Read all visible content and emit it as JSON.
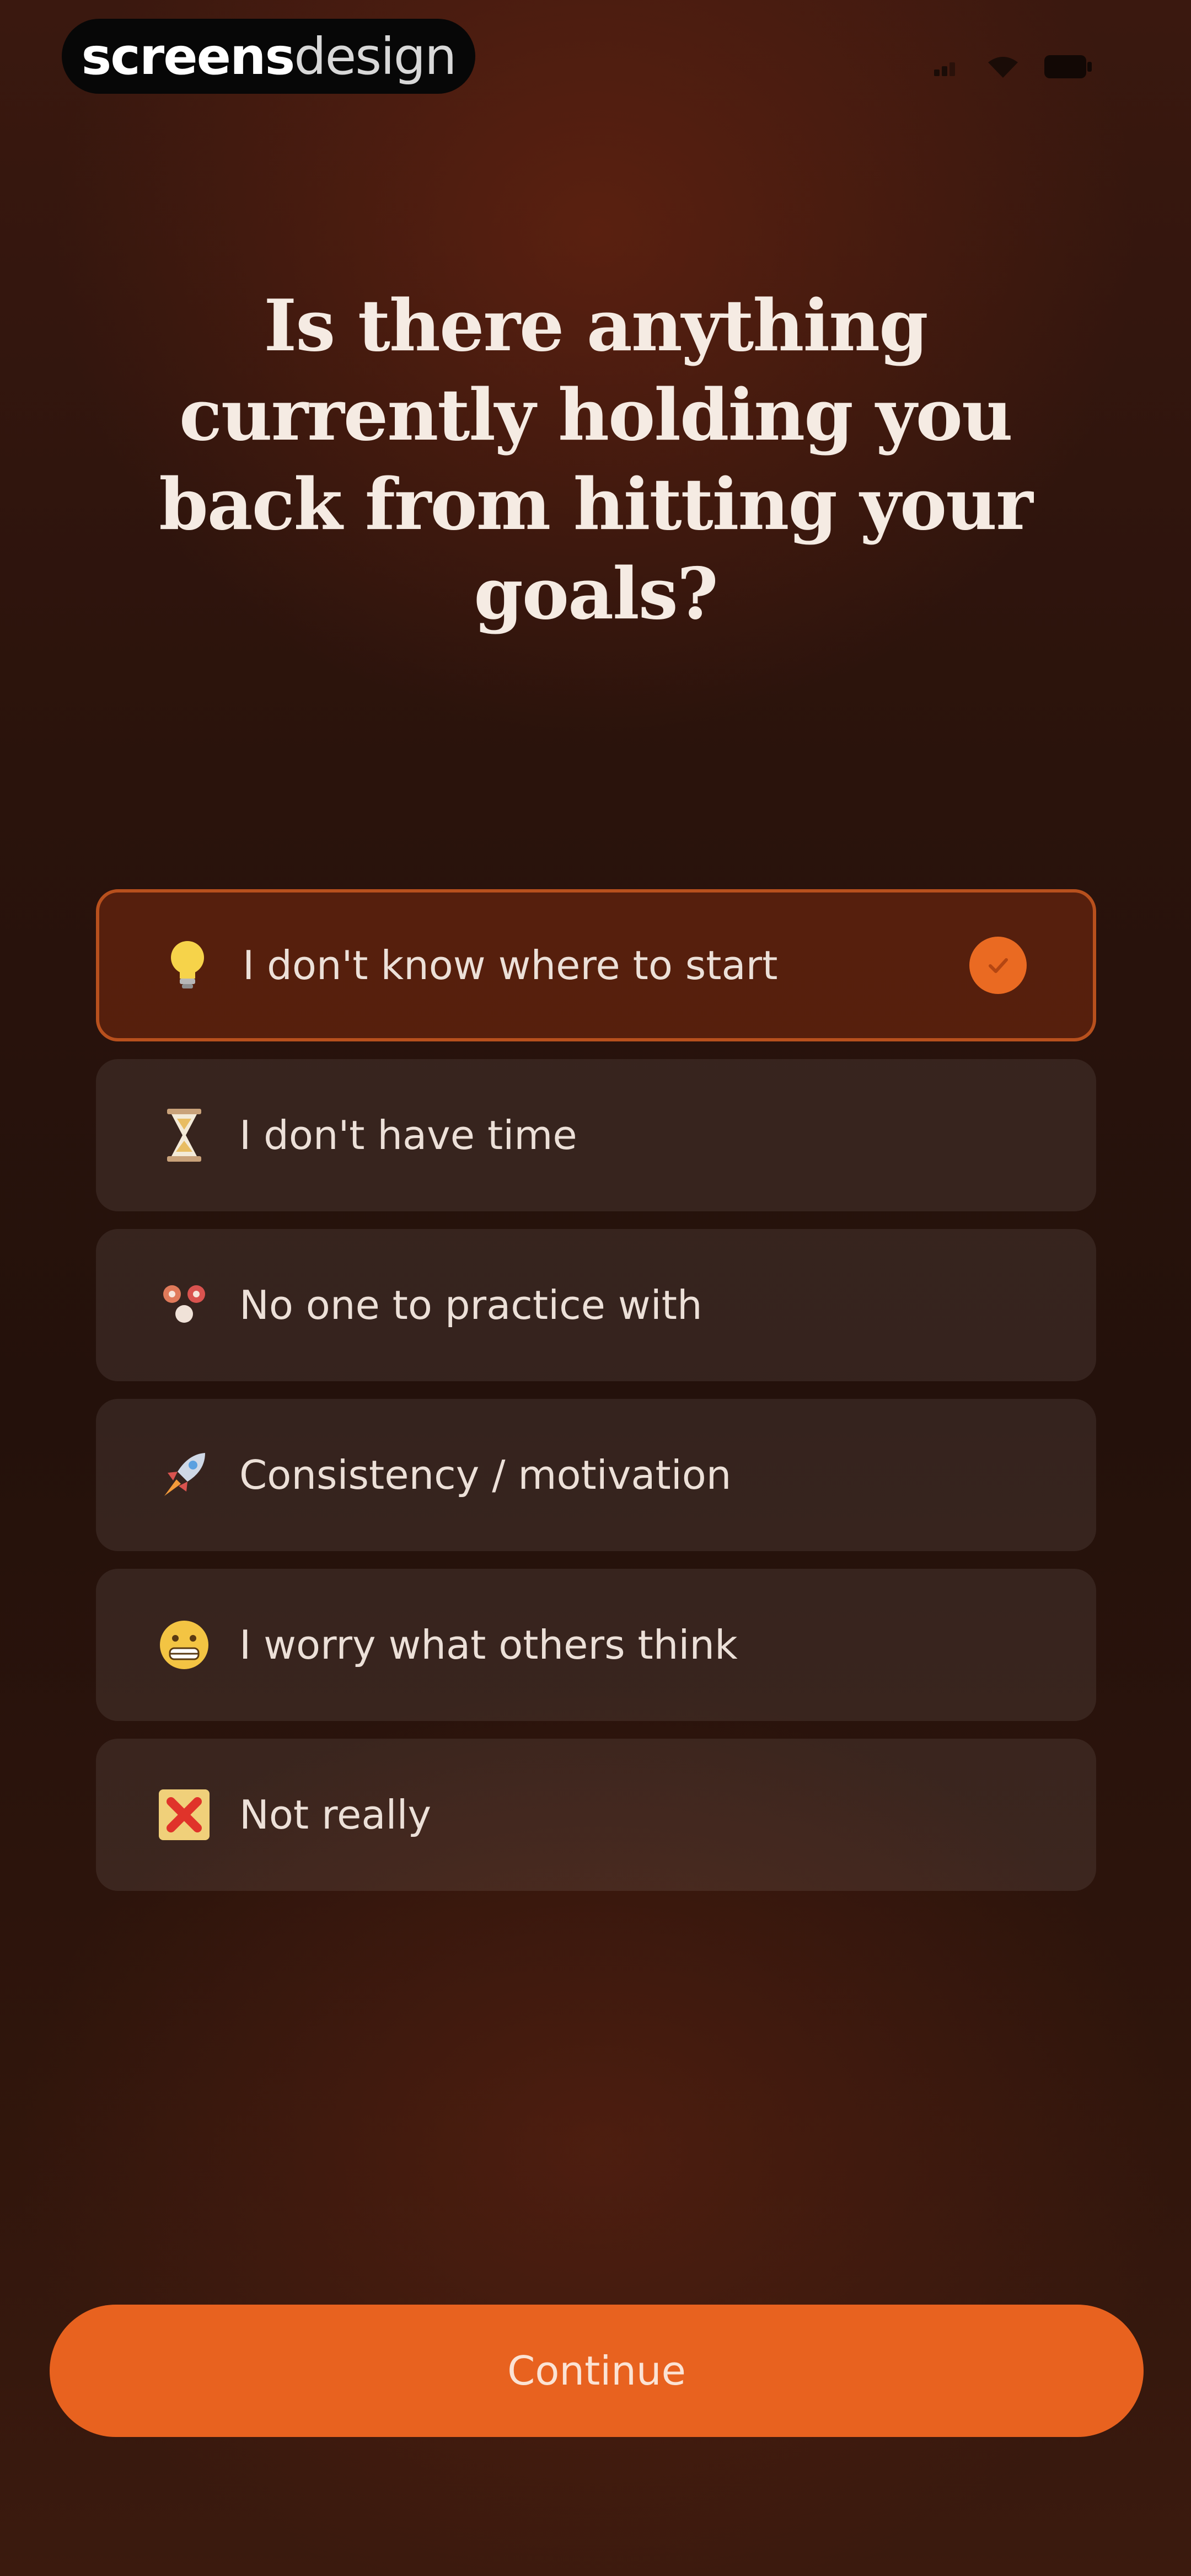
{
  "watermark": {
    "bold_text": "screens",
    "light_text": "design"
  },
  "status_bar": {
    "icons": [
      "signal-icon",
      "wifi-icon",
      "battery-icon"
    ]
  },
  "question": {
    "title": "Is there anything currently holding you back from hitting your goals?"
  },
  "options": [
    {
      "icon": "lightbulb-icon",
      "label": "I don't know where to start",
      "selected": true
    },
    {
      "icon": "hourglass-icon",
      "label": "I don't have time",
      "selected": false
    },
    {
      "icon": "people-icon",
      "label": "No one to practice with",
      "selected": false
    },
    {
      "icon": "rocket-icon",
      "label": "Consistency / motivation",
      "selected": false
    },
    {
      "icon": "grimacing-face-icon",
      "label": "I worry what others think",
      "selected": false
    },
    {
      "icon": "cross-mark-icon",
      "label": "Not really",
      "selected": false
    }
  ],
  "continue_button": {
    "label": "Continue"
  },
  "colors": {
    "accent": "#e8621f",
    "background": "#2a130c",
    "selected_border": "#b8501d"
  }
}
